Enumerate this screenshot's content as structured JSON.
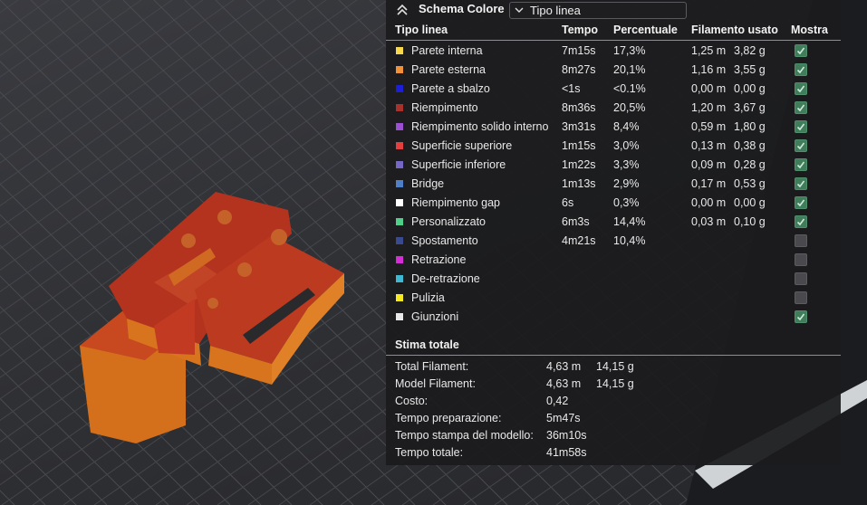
{
  "legend": {
    "title": "Schema Colore",
    "view_mode": "Tipo linea",
    "columns": {
      "type": "Tipo linea",
      "time": "Tempo",
      "percent": "Percentuale",
      "filament": "Filamento usato",
      "show": "Mostra"
    },
    "rows": [
      {
        "label": "Parete interna",
        "color": "#f7d94a",
        "time": "7m15s",
        "percent": "17,3%",
        "meters": "1,25 m",
        "grams": "3,82 g",
        "shown": true
      },
      {
        "label": "Parete esterna",
        "color": "#f29238",
        "time": "8m27s",
        "percent": "20,1%",
        "meters": "1,16 m",
        "grams": "3,55 g",
        "shown": true
      },
      {
        "label": "Parete a sbalzo",
        "color": "#1d1fd6",
        "time": "<1s",
        "percent": "<0.1%",
        "meters": "0,00 m",
        "grams": "0,00 g",
        "shown": true
      },
      {
        "label": "Riempimento",
        "color": "#a8322b",
        "time": "8m36s",
        "percent": "20,5%",
        "meters": "1,20 m",
        "grams": "3,67 g",
        "shown": true
      },
      {
        "label": "Riempimento solido interno",
        "color": "#9b4fd1",
        "time": "3m31s",
        "percent": "8,4%",
        "meters": "0,59 m",
        "grams": "1,80 g",
        "shown": true
      },
      {
        "label": "Superficie superiore",
        "color": "#e43f3f",
        "time": "1m15s",
        "percent": "3,0%",
        "meters": "0,13 m",
        "grams": "0,38 g",
        "shown": true
      },
      {
        "label": "Superficie inferiore",
        "color": "#7467c7",
        "time": "1m22s",
        "percent": "3,3%",
        "meters": "0,09 m",
        "grams": "0,28 g",
        "shown": true
      },
      {
        "label": "Bridge",
        "color": "#4f7fc7",
        "time": "1m13s",
        "percent": "2,9%",
        "meters": "0,17 m",
        "grams": "0,53 g",
        "shown": true
      },
      {
        "label": "Riempimento gap",
        "color": "#ffffff",
        "time": "6s",
        "percent": "0,3%",
        "meters": "0,00 m",
        "grams": "0,00 g",
        "shown": true
      },
      {
        "label": "Personalizzato",
        "color": "#4fcf8a",
        "time": "6m3s",
        "percent": "14,4%",
        "meters": "0,03 m",
        "grams": "0,10 g",
        "shown": true
      },
      {
        "label": "Spostamento",
        "color": "#3a4a8f",
        "time": "4m21s",
        "percent": "10,4%",
        "meters": "",
        "grams": "",
        "shown": false
      },
      {
        "label": "Retrazione",
        "color": "#d42fd4",
        "time": "",
        "percent": "",
        "meters": "",
        "grams": "",
        "shown": false
      },
      {
        "label": "De-retrazione",
        "color": "#3fb8d4",
        "time": "",
        "percent": "",
        "meters": "",
        "grams": "",
        "shown": false
      },
      {
        "label": "Pulizia",
        "color": "#f5ea1f",
        "time": "",
        "percent": "",
        "meters": "",
        "grams": "",
        "shown": false
      },
      {
        "label": "Giunzioni",
        "color": "#e8e8e8",
        "time": "",
        "percent": "",
        "meters": "",
        "grams": "",
        "shown": true
      }
    ]
  },
  "estimate": {
    "title": "Stima totale",
    "rows": [
      {
        "label": "Total Filament:",
        "value": "4,63 m",
        "value2": "14,15 g"
      },
      {
        "label": "Model Filament:",
        "value": "4,63 m",
        "value2": "14,15 g"
      },
      {
        "label": "Costo:",
        "value": "0,42",
        "value2": ""
      },
      {
        "label": "Tempo preparazione:",
        "value": "5m47s",
        "value2": ""
      },
      {
        "label": "Tempo stampa del modello:",
        "value": "36m10s",
        "value2": ""
      },
      {
        "label": "Tempo totale:",
        "value": "41m58s",
        "value2": ""
      }
    ]
  },
  "icons": {
    "collapse": "chevron-double-up-icon",
    "dropdown": "chevron-down-icon",
    "checked": "checkmark-icon"
  },
  "colors": {
    "panel_bg": "#1c1c1e",
    "model_orange": "#d9741e",
    "model_red": "#b5321e",
    "checkbox_green": "#3f7d5b"
  }
}
